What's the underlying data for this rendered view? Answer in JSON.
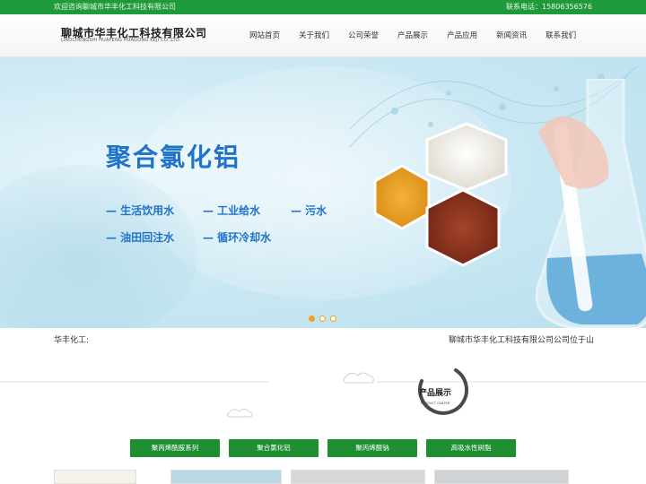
{
  "topbar": {
    "welcome": "欢迎咨询聊城市华丰化工科技有限公司",
    "phone_text": "联系电话：15806356576"
  },
  "header": {
    "company_cn": "聊城市华丰化工科技有限公司",
    "company_en": "LIAOCHENGSHI HUAFENG HUAGONG KEJI CO.,LTD."
  },
  "nav": {
    "items": [
      "网站首页",
      "关于我们",
      "公司荣誉",
      "产品展示",
      "产品应用",
      "新闻资讯",
      "联系我们"
    ]
  },
  "banner": {
    "title": "聚合氯化铝",
    "uses": [
      "— 生活饮用水",
      "— 工业给水",
      "— 污水",
      "— 油田回注水",
      "— 循环冷却水"
    ],
    "slide_count": 3,
    "active_slide": 1
  },
  "news": {
    "label": "华丰化工:",
    "text": "聊城市华丰化工科技有限公司公司位于山"
  },
  "section": {
    "heading_cn": "产品展示",
    "heading_en": "PRODUCT CENTER"
  },
  "tabs": [
    "聚丙烯酰胺系列",
    "聚合氯化铝",
    "聚丙烯酸钠",
    "高吸水性树脂"
  ],
  "colors": {
    "brand_green": "#1f9a3a",
    "title_blue": "#1f73c9",
    "dot_orange": "#f0a020"
  }
}
